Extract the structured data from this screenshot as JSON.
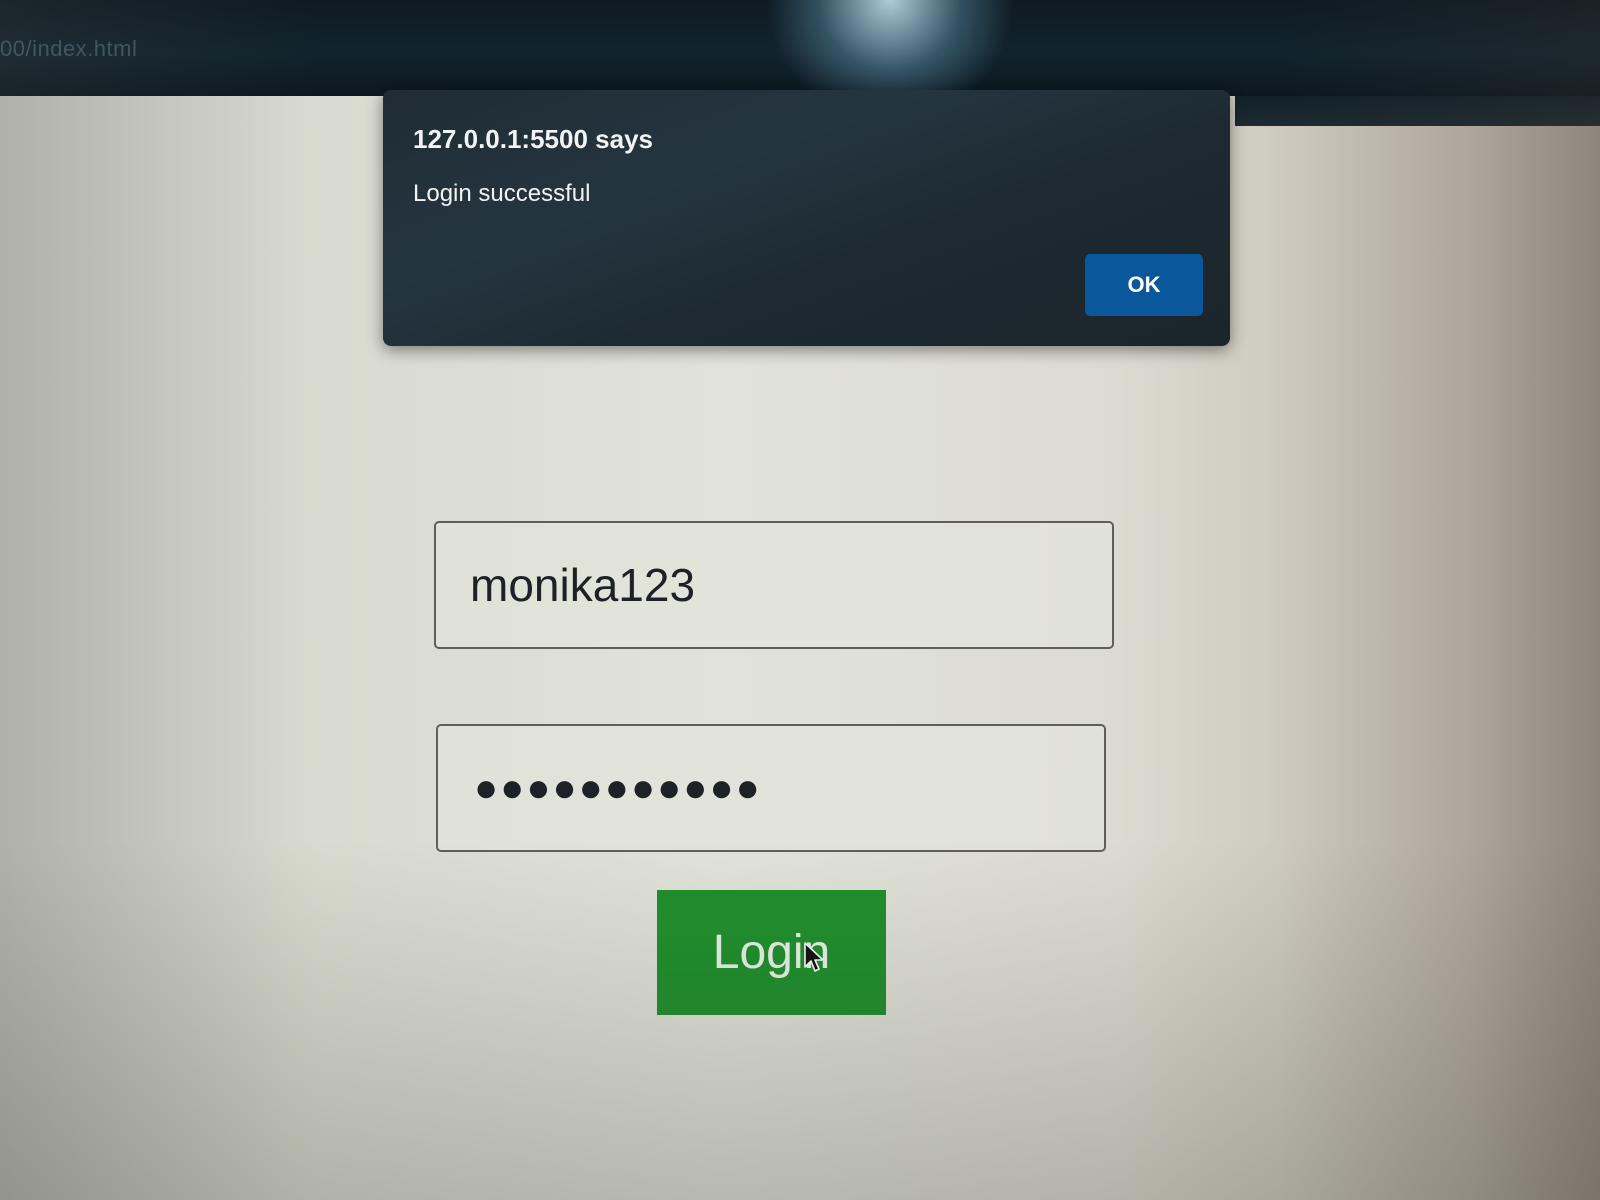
{
  "browser": {
    "url_fragment": "00/index.html"
  },
  "alert": {
    "title": "127.0.0.1:5500 says",
    "message": "Login successful",
    "ok_label": "OK"
  },
  "login": {
    "username_value": "monika123",
    "password_mask": "●●●●●●●●●●●",
    "button_label": "Login"
  },
  "colors": {
    "alert_background": "#1f2c34",
    "ok_button": "#0b579c",
    "login_button": "#1e8f2c",
    "page_background": "#dcded4"
  },
  "icons": {
    "cursor": "mouse-pointer-icon"
  }
}
